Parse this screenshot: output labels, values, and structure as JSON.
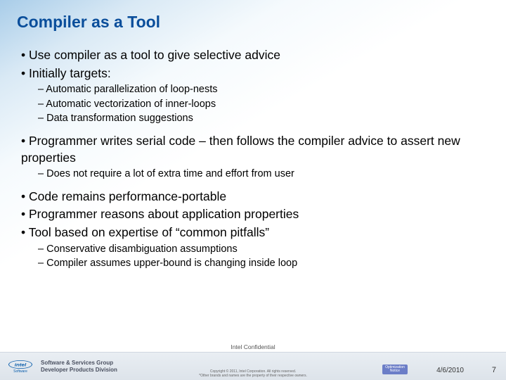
{
  "title": "Compiler as a Tool",
  "bullets": {
    "b1": "Use compiler as a tool to give selective advice",
    "b2": "Initially targets:",
    "b2a": "Automatic parallelization of loop-nests",
    "b2b": "Automatic vectorization of inner-loops",
    "b2c": "Data transformation suggestions",
    "b3": "Programmer writes serial code – then follows the compiler advice to assert new properties",
    "b3a": "Does not require a lot of extra time and effort from user",
    "b4": "Code remains performance-portable",
    "b5": "Programmer reasons about application properties",
    "b6": "Tool based on expertise of “common pitfalls”",
    "b6a": "Conservative disambiguation assumptions",
    "b6b": "Compiler assumes upper-bound is changing inside loop"
  },
  "footer": {
    "logo_text": "intel",
    "logo_sub": "Software",
    "group_line1": "Software & Services Group",
    "group_line2": "Developer Products Division",
    "confidential": "Intel Confidential",
    "copyright_l1": "Copyright © 2011, Intel Corporation. All rights reserved.",
    "copyright_l2": "*Other brands and names are the property of their respective owners.",
    "notice": "Optimization Notice",
    "date": "4/6/2010",
    "page": "7"
  }
}
